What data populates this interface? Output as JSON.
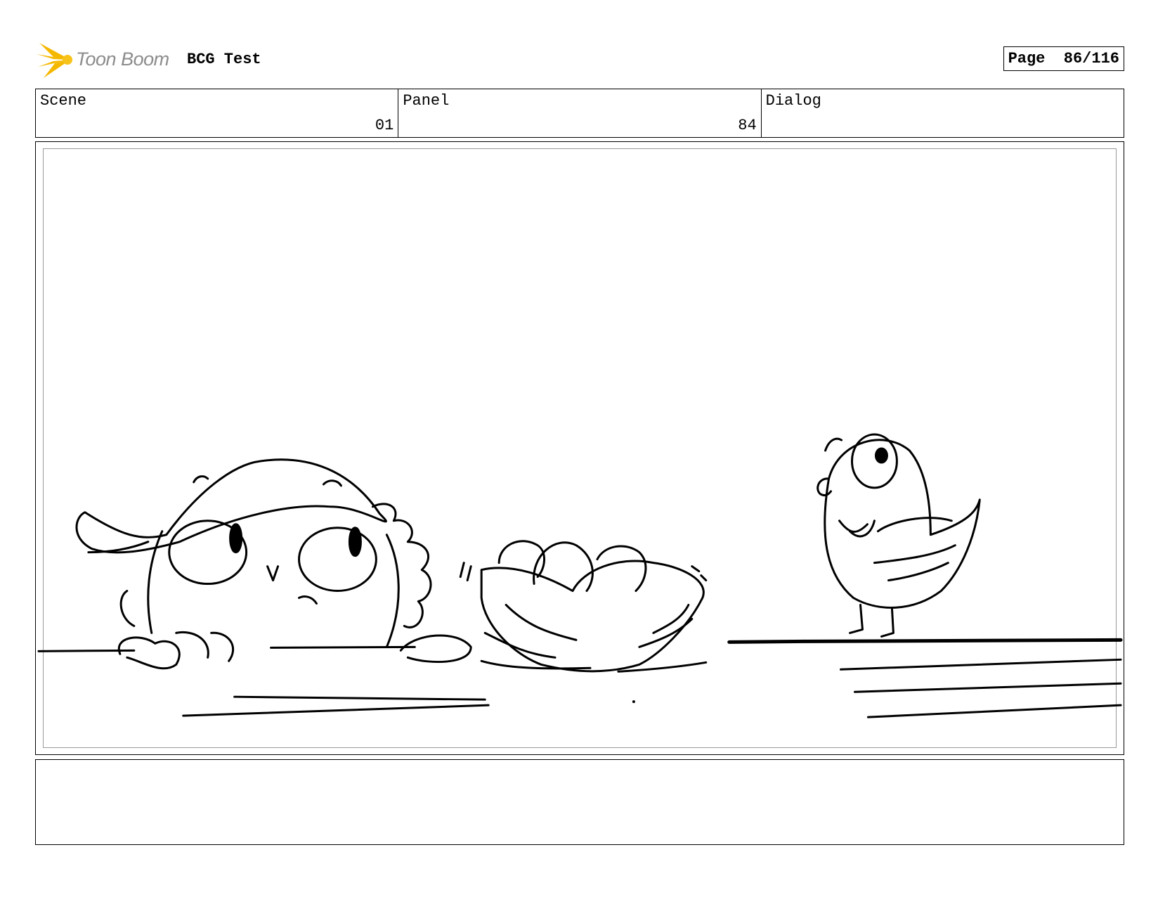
{
  "header": {
    "logo_text": "Toon Boom",
    "project_title": "BCG Test",
    "page_label": "Page",
    "page_number": "86/116"
  },
  "info": {
    "scene_label": "Scene",
    "scene_value": "01",
    "panel_label": "Panel",
    "panel_value": "84",
    "dialog_label": "Dialog",
    "dialog_value": ""
  },
  "notes": {
    "text": ""
  },
  "colors": {
    "logo_accent": "#f5b800",
    "logo_text": "#8c8c8c",
    "line": "#000000",
    "inner_border": "#9a9a9a"
  },
  "icons": {
    "logo": "toon-boom-burst-icon"
  }
}
